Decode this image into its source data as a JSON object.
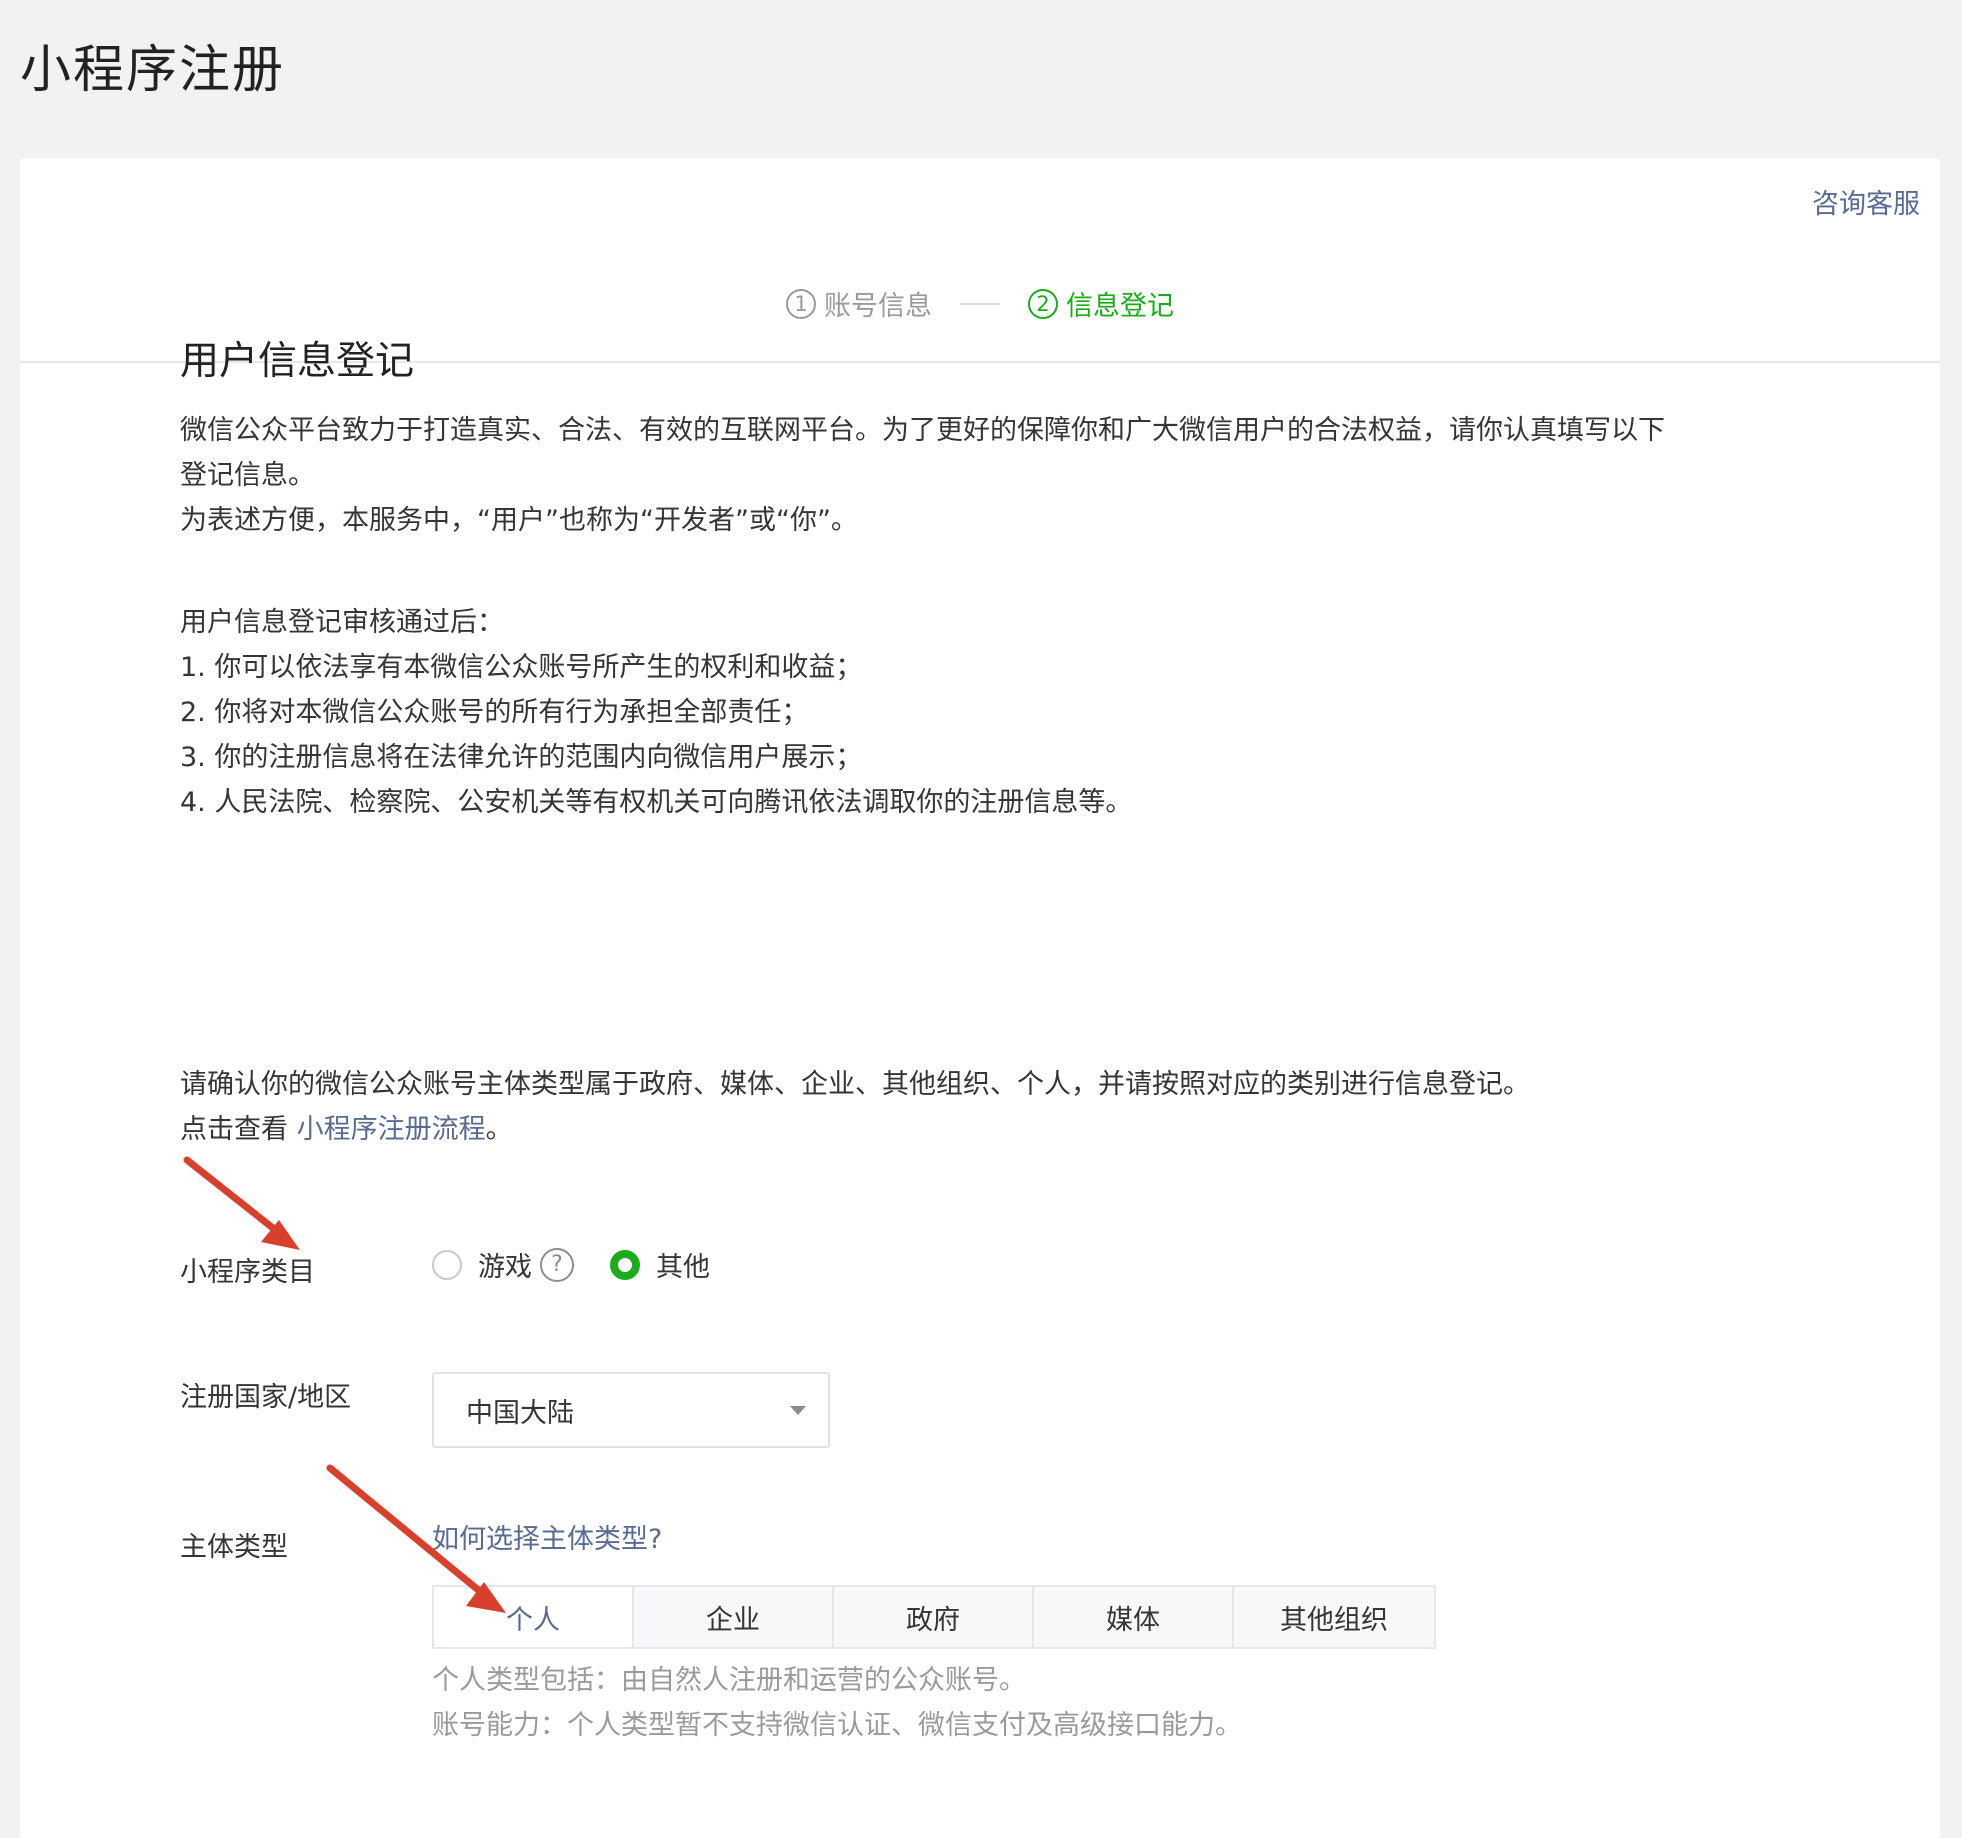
{
  "page_title": "小程序注册",
  "header": {
    "service_link": "咨询客服",
    "steps": [
      {
        "num": "1",
        "label": "账号信息",
        "state": "done"
      },
      {
        "num": "2",
        "label": "信息登记",
        "state": "active"
      }
    ]
  },
  "section_title": "用户信息登记",
  "intro_lines": [
    "微信公众平台致力于打造真实、合法、有效的互联网平台。为了更好的保障你和广大微信用户的合法权益，请你认真填写以下",
    "登记信息。",
    "为表述方便，本服务中，“用户”也称为“开发者”或“你”。"
  ],
  "after_review": {
    "heading": "用户信息登记审核通过后：",
    "items": [
      "1. 你可以依法享有本微信公众账号所产生的权利和收益；",
      "2. 你将对本微信公众账号的所有行为承担全部责任；",
      "3. 你的注册信息将在法律允许的范围内向微信用户展示；",
      "4. 人民法院、检察院、公安机关等有权机关可向腾讯依法调取你的注册信息等。"
    ]
  },
  "confirm": {
    "line1": "请确认你的微信公众账号主体类型属于政府、媒体、企业、其他组织、个人，并请按照对应的类别进行信息登记。",
    "line2_prefix": "点击查看 ",
    "line2_link": "小程序注册流程",
    "line2_suffix": "。"
  },
  "form": {
    "category": {
      "label": "小程序类目",
      "options": [
        {
          "label": "游戏",
          "checked": false
        },
        {
          "label": "其他",
          "checked": true
        }
      ],
      "help_icon": "?"
    },
    "region": {
      "label": "注册国家/地区",
      "selected": "中国大陆"
    },
    "entity_type": {
      "label": "主体类型",
      "help_link": "如何选择主体类型?",
      "tabs": [
        "个人",
        "企业",
        "政府",
        "媒体",
        "其他组织"
      ],
      "active_tab": "个人",
      "tips": [
        "个人类型包括：由自然人注册和运营的公众账号。",
        "账号能力：个人类型暂不支持微信认证、微信支付及高级接口能力。"
      ]
    }
  },
  "colors": {
    "accent_green": "#1aad19",
    "link_blue": "#576b95",
    "annotation_red": "#d9402b"
  },
  "icons": [
    "help-icon",
    "chevron-down-icon",
    "red-arrow-annotation"
  ]
}
